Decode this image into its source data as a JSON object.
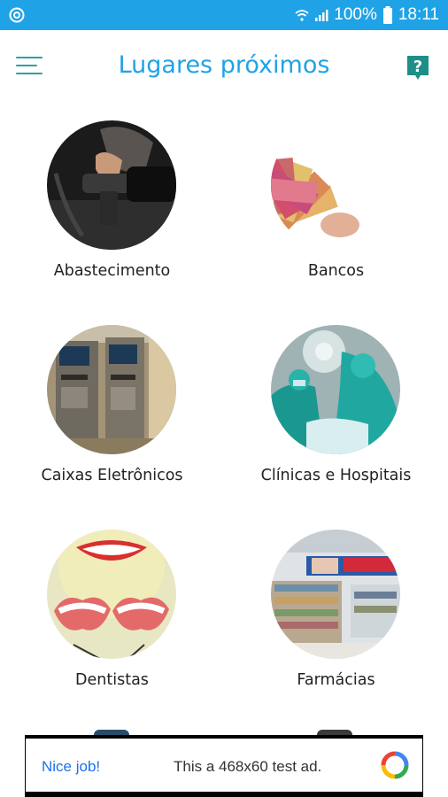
{
  "status_bar": {
    "battery": "100%",
    "time": "18:11"
  },
  "header": {
    "title": "Lugares próximos"
  },
  "categories": [
    {
      "label": "Abastecimento"
    },
    {
      "label": "Bancos"
    },
    {
      "label": "Caixas Eletrônicos"
    },
    {
      "label": "Clínicas e Hospitais"
    },
    {
      "label": "Dentistas"
    },
    {
      "label": "Farmácias"
    }
  ],
  "ad": {
    "cta": "Nice job!",
    "text": "This a 468x60 test ad."
  },
  "colors": {
    "status_bar": "#1fa3e6",
    "title": "#1fa3e6",
    "accent": "#2aa3a0"
  }
}
